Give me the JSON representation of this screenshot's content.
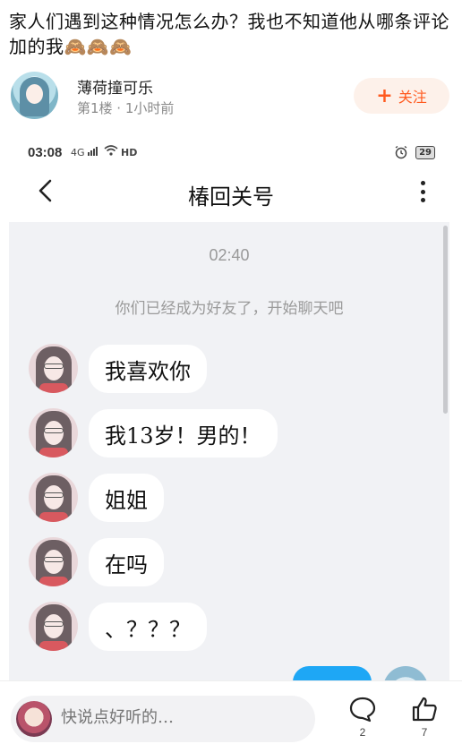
{
  "post": {
    "title": "家人们遇到这种情况怎么办？我也不知道他从哪条评论加的我🙈🙈🙈"
  },
  "author": {
    "name": "薄荷撞可乐",
    "meta": "第1楼 · 1小时前",
    "follow_label": "关注",
    "follow_icon": "plus-icon"
  },
  "phone_status": {
    "time": "03:08",
    "signal_text": "4G",
    "hd_text": "HD",
    "battery": "29"
  },
  "chat": {
    "back_icon": "chevron-left-icon",
    "title": "椿回关号",
    "more_icon": "more-vertical-icon",
    "timestamp": "02:40",
    "system_note": "你们已经成为好友了，开始聊天吧",
    "messages": [
      {
        "text": "我喜欢你"
      },
      {
        "text": "我13岁！男的！"
      },
      {
        "text": "姐姐"
      },
      {
        "text": "在吗"
      },
      {
        "text": "、？？？"
      }
    ]
  },
  "bottom": {
    "placeholder": "快说点好听的…",
    "comment_count": "2",
    "like_count": "7"
  },
  "colors": {
    "accent": "#ff5a1f",
    "follow_bg": "#fdf1ea",
    "chat_bg": "#f1f2f5",
    "my_bubble": "#1ea7f5"
  }
}
